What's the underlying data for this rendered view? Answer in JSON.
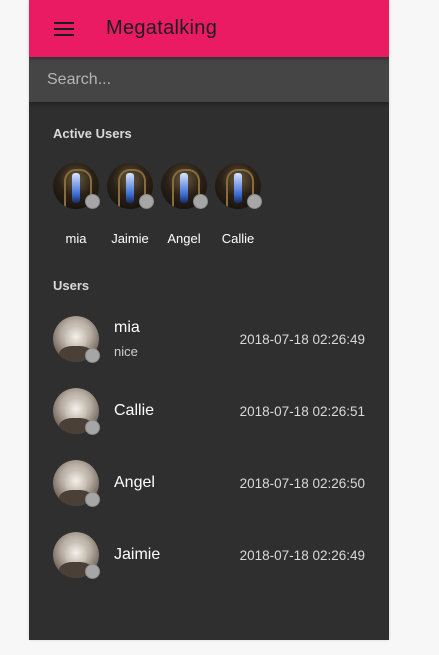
{
  "appbar": {
    "title": "Megatalking",
    "menu_icon": "menu-icon",
    "color": "#ea1b63"
  },
  "search": {
    "placeholder": "Search...",
    "value": ""
  },
  "active_users": {
    "title": "Active Users",
    "items": [
      {
        "name": "mia"
      },
      {
        "name": "Jaimie"
      },
      {
        "name": "Angel"
      },
      {
        "name": "Callie"
      }
    ]
  },
  "users": {
    "title": "Users",
    "items": [
      {
        "name": "mia",
        "message": "nice",
        "time": "2018-07-18 02:26:49"
      },
      {
        "name": "Callie",
        "message": "",
        "time": "2018-07-18 02:26:51"
      },
      {
        "name": "Angel",
        "message": "",
        "time": "2018-07-18 02:26:50"
      },
      {
        "name": "Jaimie",
        "message": "",
        "time": "2018-07-18 02:26:49"
      }
    ]
  },
  "status_color": "#a6a6a6"
}
